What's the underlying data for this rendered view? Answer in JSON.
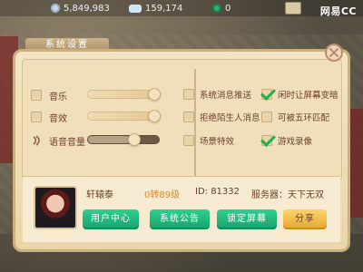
{
  "topbar": {
    "coins": "5,849,983",
    "silver": "159,174",
    "jade": "0",
    "brand": "网易CC"
  },
  "dialog": {
    "title": "系统设置",
    "audio": [
      {
        "label": "音乐",
        "checked": false,
        "level": 1.0
      },
      {
        "label": "音效",
        "checked": false,
        "level": 1.0
      },
      {
        "label": "语音音量",
        "checked": false,
        "level": 0.6
      }
    ],
    "options": [
      {
        "label": "系统消息推送",
        "checked": false
      },
      {
        "label": "闲时让屏幕变暗",
        "checked": true
      },
      {
        "label": "拒绝陌生人消息",
        "checked": false
      },
      {
        "label": "可被五环匹配",
        "checked": false
      },
      {
        "label": "场景特效",
        "checked": false
      },
      {
        "label": "游戏录像",
        "checked": true
      }
    ],
    "account": {
      "name": "轩辕泰",
      "level": "0转89级",
      "id": "ID: 81332",
      "server": "服务器：天下无双"
    },
    "buttons": {
      "user_center": "用户中心",
      "announcement": "系统公告",
      "lock_screen": "锁定屏幕",
      "share": "分享"
    }
  },
  "colors": {
    "accent_green": "#16a36d",
    "accent_gold": "#e2a72f",
    "text_brown": "#6b3f2a"
  }
}
